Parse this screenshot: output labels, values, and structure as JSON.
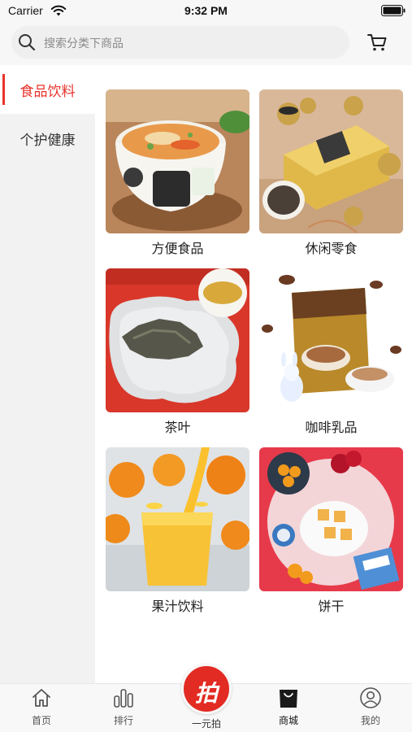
{
  "status_bar": {
    "carrier": "Carrier",
    "time": "9:32 PM"
  },
  "search": {
    "placeholder": "搜索分类下商品",
    "icon": "search-icon"
  },
  "header": {
    "cart_icon": "cart-icon"
  },
  "sidebar": {
    "items": [
      {
        "label": "食品饮料",
        "active": true
      },
      {
        "label": "个护健康",
        "active": false
      }
    ]
  },
  "categories": [
    {
      "label": "方便食品",
      "thumb": "instant-noodle-bowl"
    },
    {
      "label": "休闲零食",
      "thumb": "snack-gift-box"
    },
    {
      "label": "茶叶",
      "thumb": "tea-leaves-plate"
    },
    {
      "label": "咖啡乳品",
      "thumb": "coffee-package"
    },
    {
      "label": "果汁饮料",
      "thumb": "orange-juice-glass"
    },
    {
      "label": "饼干",
      "thumb": "biscuits-plate"
    }
  ],
  "tabbar": {
    "tabs": [
      {
        "label": "首页",
        "icon": "home-icon"
      },
      {
        "label": "排行",
        "icon": "ranking-icon"
      },
      {
        "label": "一元拍",
        "icon": "auction-icon",
        "glyph": "拍"
      },
      {
        "label": "商城",
        "icon": "shopping-bag-icon",
        "active": true
      },
      {
        "label": "我的",
        "icon": "profile-icon"
      }
    ]
  },
  "colors": {
    "accent": "#e8332b",
    "sidebar_bg": "#f2f2f2",
    "center_button": "#e22b23"
  }
}
